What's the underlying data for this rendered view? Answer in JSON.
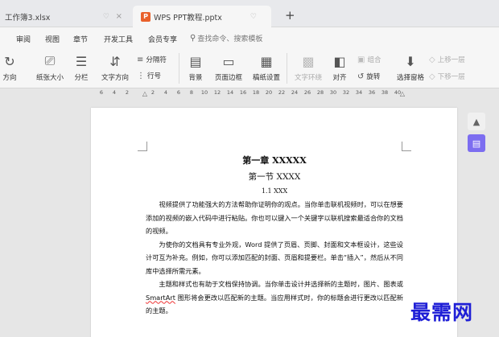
{
  "tabs": [
    {
      "label": "工作簿3.xlsx",
      "pin": "♡",
      "close": "×"
    },
    {
      "badge": "P",
      "label": "WPS PPT教程.pptx",
      "pin": "♡"
    }
  ],
  "new_tab": "+",
  "menu": {
    "items": [
      "审阅",
      "视图",
      "章节",
      "开发工具",
      "会员专享"
    ],
    "search": "查找命令、搜索模板"
  },
  "ribbon": {
    "direction": "方向",
    "paper_size": "纸张大小",
    "columns": "分栏",
    "text_direction": "文字方向",
    "separator": "分隔符",
    "line_number": "行号",
    "background": "背景",
    "page_border": "页面边框",
    "draft": "稿纸设置",
    "text_wrap": "文字环绕",
    "align": "对齐",
    "rotate": "旋转",
    "group": "组合",
    "selection_pane": "选择窗格",
    "bring_forward": "上移一层",
    "send_backward": "下移一层"
  },
  "ruler": {
    "ticks": [
      "6",
      "4",
      "2",
      "",
      "2",
      "4",
      "6",
      "8",
      "10",
      "12",
      "14",
      "16",
      "18",
      "20",
      "22",
      "24",
      "26",
      "28",
      "30",
      "32",
      "34",
      "36",
      "38",
      "40"
    ]
  },
  "document": {
    "chapter": "第一章 XXXXX",
    "section": "第一节 XXXX",
    "subsection": "1.1 XXX",
    "p1": "视频提供了功能强大的方法帮助你证明你的观点。当你单击联机视频时，可以在想要添加的视频的嵌入代码中进行粘贴。你也可以键入一个关键字以联机搜索最适合你的文档的视频。",
    "p2": "为使你的文档具有专业外观，Word 提供了页眉、页脚、封面和文本框设计，这些设计可互为补充。例如，你可以添加匹配的封面、页眉和提要栏。单击“插入”，然后从不同库中选择所需元素。",
    "p3_a": "主题和样式也有助于文档保持协调。当你单击设计并选择新的主题时，图片、图表或 ",
    "p3_smartart": "SmartArt",
    "p3_b": " 图形将会更改以匹配新的主题。当应用样式时，你的标题会进行更改以匹配新的主题。"
  },
  "watermark": "最需网",
  "colors": {
    "ppt_badge": "#e9602b",
    "side_active": "#7c6df0",
    "watermark": "#1f1fd6"
  }
}
